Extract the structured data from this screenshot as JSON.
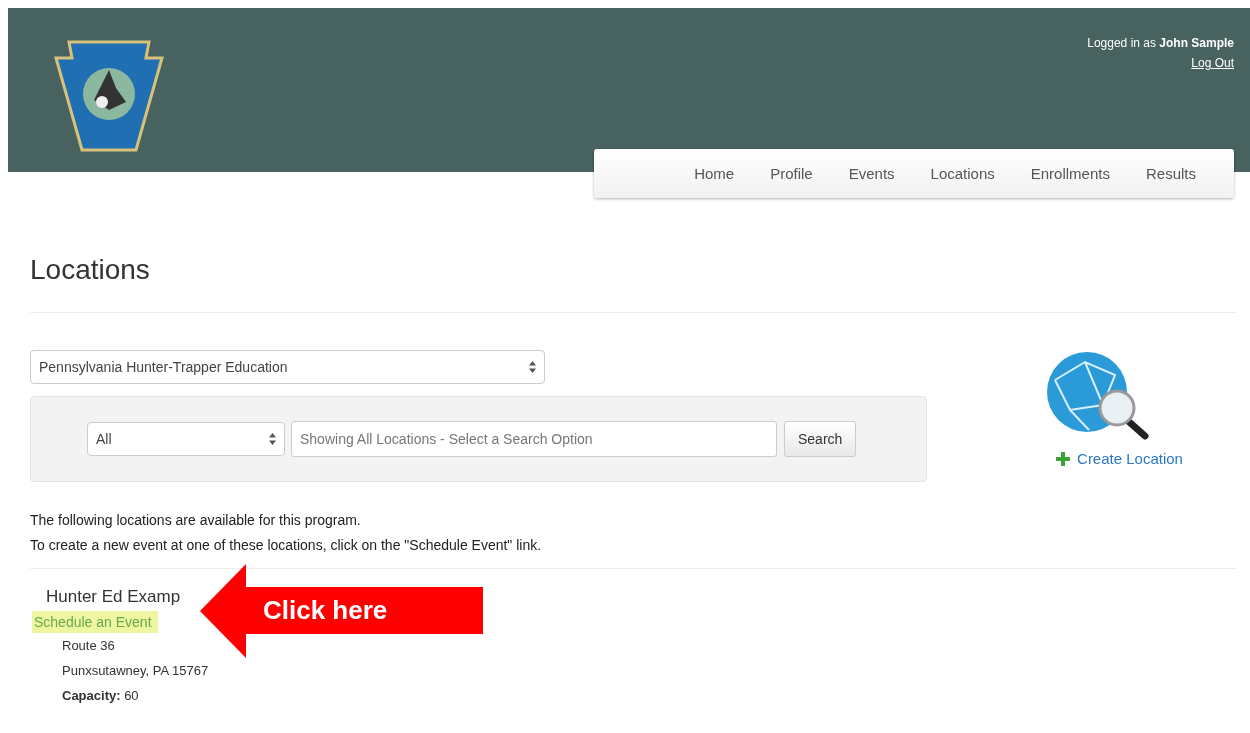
{
  "header": {
    "login_prefix": "Logged in as",
    "user_name": "John Sample",
    "logout": "Log Out"
  },
  "nav": [
    {
      "label": "Home",
      "selected": false
    },
    {
      "label": "Profile",
      "selected": false
    },
    {
      "label": "Events",
      "selected": false
    },
    {
      "label": "Locations",
      "selected": false
    },
    {
      "label": "Enrollments",
      "selected": false
    },
    {
      "label": "Results",
      "selected": false
    }
  ],
  "page_title": "Locations",
  "program_select": {
    "value": "Pennsylvania Hunter-Trapper Education"
  },
  "search": {
    "filter": "All",
    "placeholder": "Showing All Locations - Select a Search Option",
    "button": "Search"
  },
  "create_link": "Create Location",
  "intro": [
    "The following locations are available for this program.",
    "To create a new event at one of these locations, click on the \"Schedule Event\" link."
  ],
  "locations": [
    {
      "name": "Hunter Ed Examp",
      "schedule_link": "Schedule an Event",
      "address": [
        "Route 36",
        "Punxsutawney, PA 15767"
      ],
      "capacity_label": "Capacity:",
      "capacity": "60"
    }
  ],
  "callout": {
    "text": "Click here"
  }
}
